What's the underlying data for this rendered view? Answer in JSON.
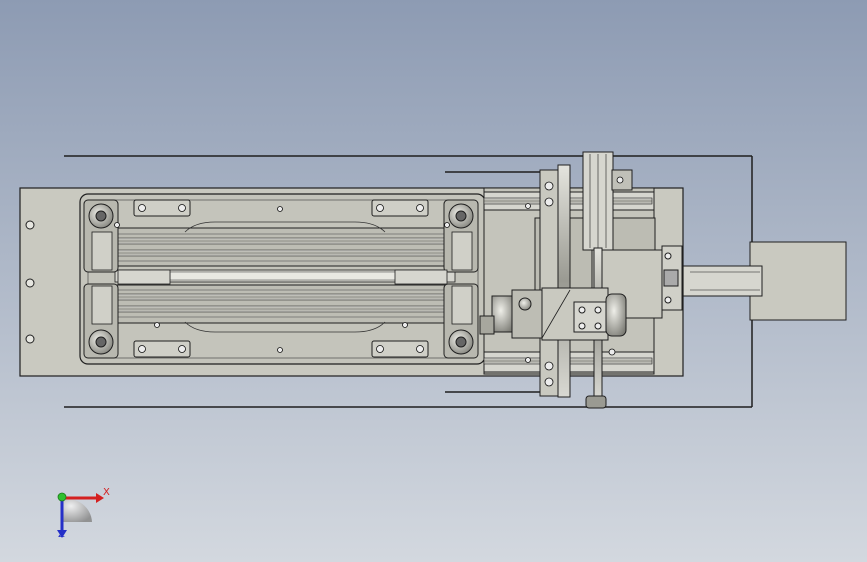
{
  "viewport": {
    "background_top": "#8d9bb3",
    "background_bottom": "#d3d8df",
    "part_fill": "#c9c9c0",
    "part_fill_light": "#d6d6cf",
    "part_fill_dark": "#a7a79e",
    "edge_color": "#1f1f1f"
  },
  "triad": {
    "x_label": "X",
    "z_label": "Z",
    "x_color": "#d42020",
    "y_color": "#2fbf2f",
    "z_color": "#2530c8"
  }
}
